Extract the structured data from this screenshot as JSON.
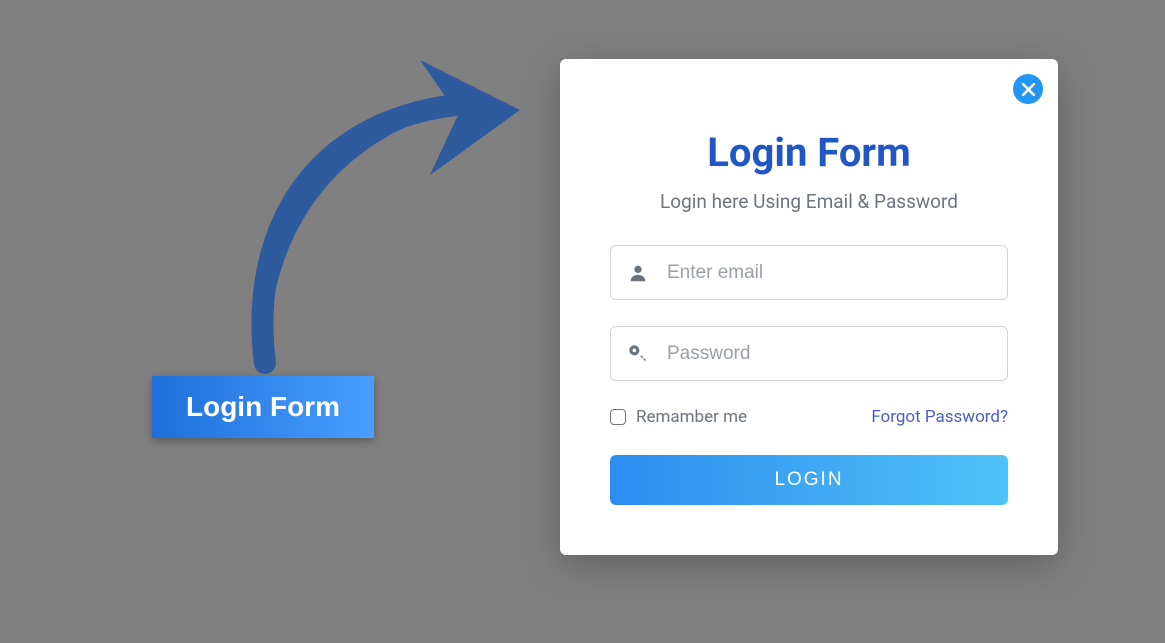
{
  "trigger": {
    "label": "Login Form"
  },
  "modal": {
    "title": "Login Form",
    "subtitle": "Login here Using Email & Password",
    "email_placeholder": "Enter email",
    "password_placeholder": "Password",
    "remember_label": "Remamber me",
    "forgot_label": "Forgot Password?",
    "login_label": "LOGIN"
  }
}
